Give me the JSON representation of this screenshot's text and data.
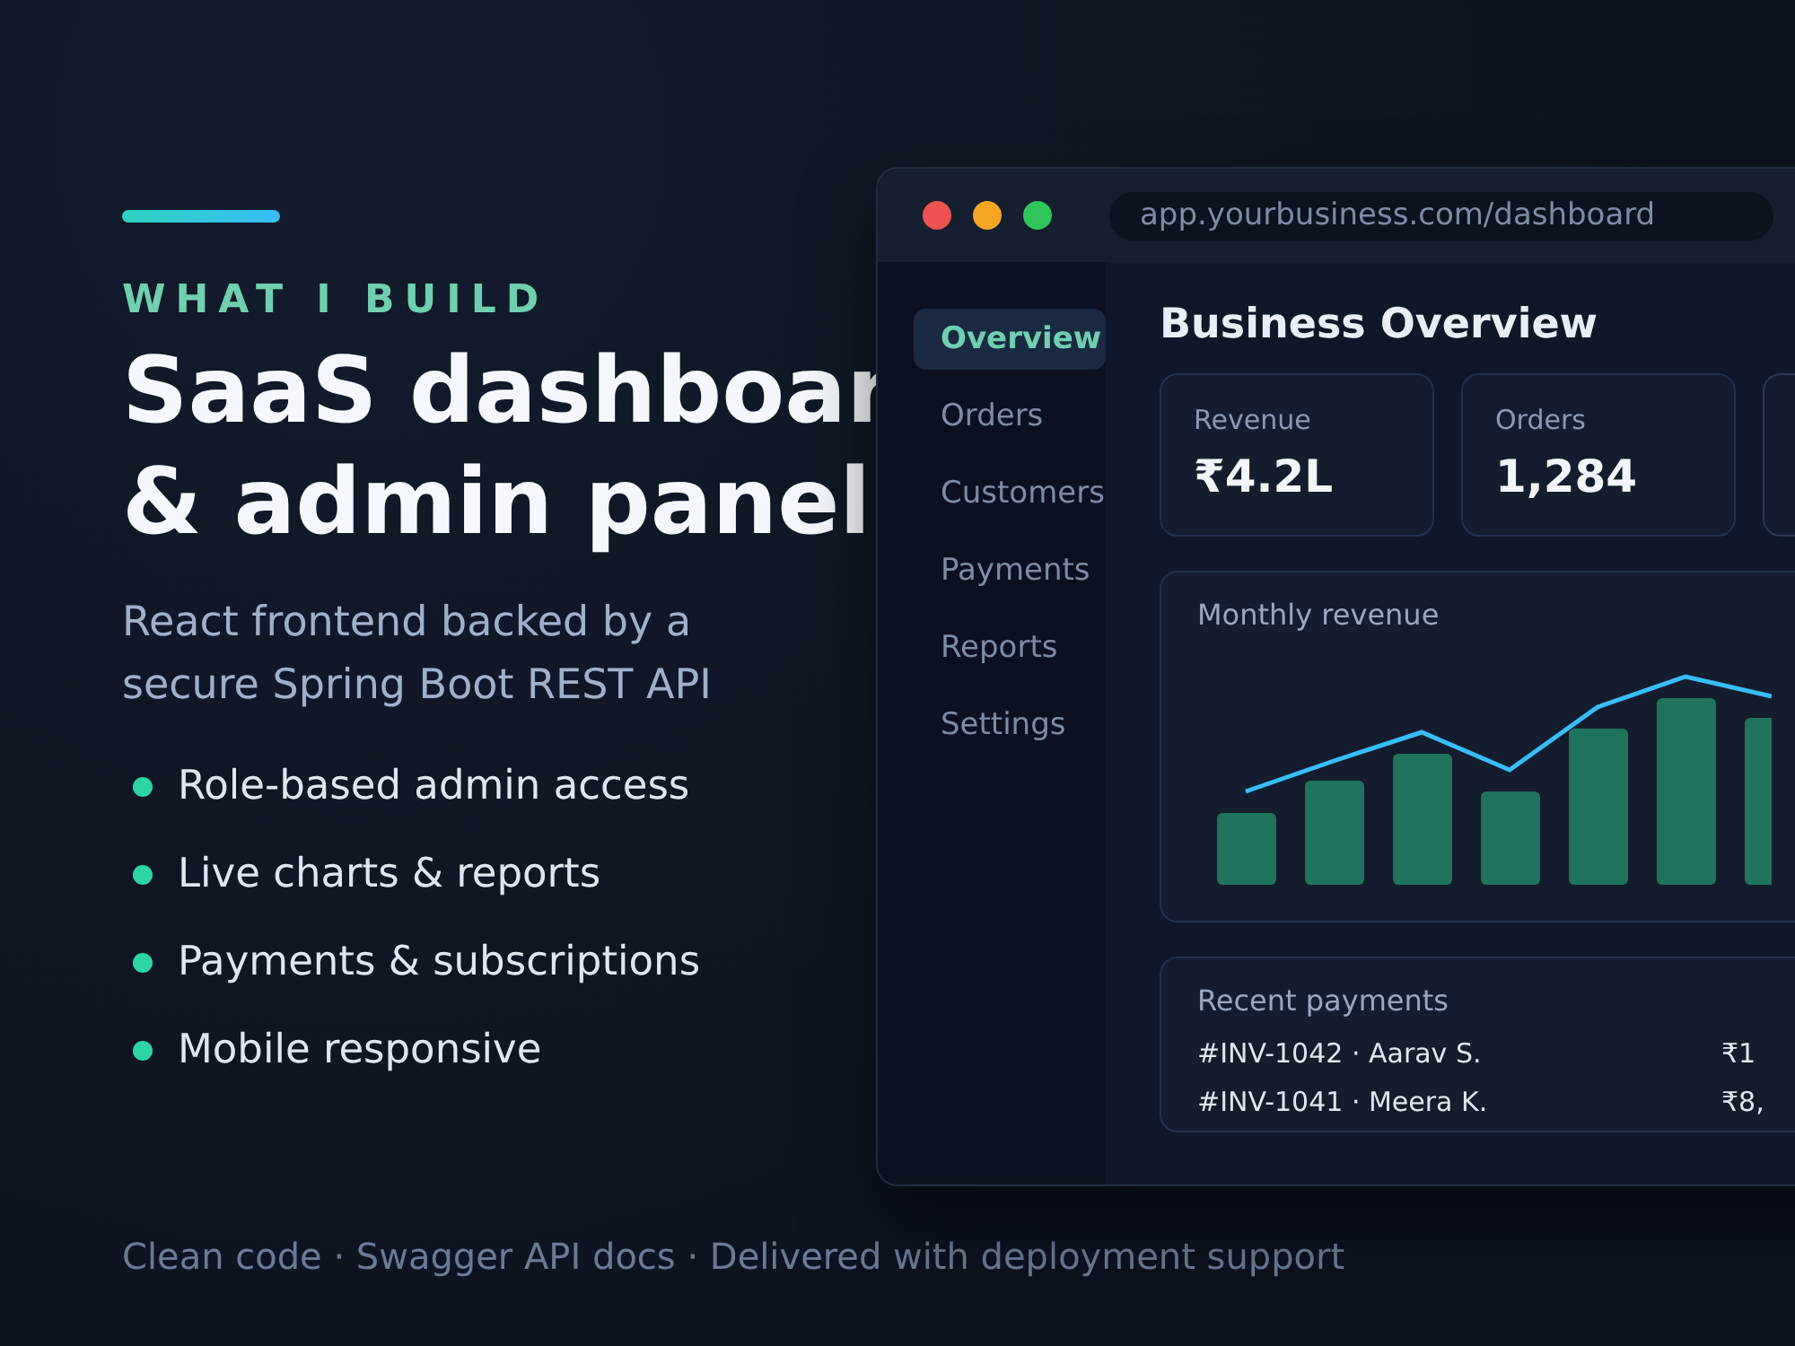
{
  "eyebrow": "WHAT I BUILD",
  "headline": [
    "SaaS dashboar",
    "& admin panel"
  ],
  "subtitle": "React frontend backed by a secure Spring Boot REST API",
  "features": [
    "Role-based admin access",
    "Live charts & reports",
    "Payments & subscriptions",
    "Mobile responsive"
  ],
  "footer": "Clean code · Swagger API docs · Delivered with deployment support",
  "window": {
    "url": "app.yourbusiness.com/dashboard",
    "sidebar": {
      "items": [
        {
          "label": "Overview",
          "selected": true
        },
        {
          "label": "Orders",
          "selected": false
        },
        {
          "label": "Customers",
          "selected": false
        },
        {
          "label": "Payments",
          "selected": false
        },
        {
          "label": "Reports",
          "selected": false
        },
        {
          "label": "Settings",
          "selected": false
        }
      ]
    },
    "title": "Business Overview",
    "stats": [
      {
        "kind": "stat",
        "label": "Revenue",
        "value": "₹4.2L"
      },
      {
        "kind": "stat",
        "label": "Orders",
        "value": "1,284"
      },
      {
        "kind": "edge"
      }
    ],
    "chart": {
      "title": "Monthly revenue"
    },
    "payments": {
      "title": "Recent payments",
      "rows": [
        {
          "invoice": "#INV-1042 · Aarav S.",
          "amount": "₹1"
        },
        {
          "invoice": "#INV-1041 · Meera K.",
          "amount": "₹8,"
        }
      ]
    }
  }
}
